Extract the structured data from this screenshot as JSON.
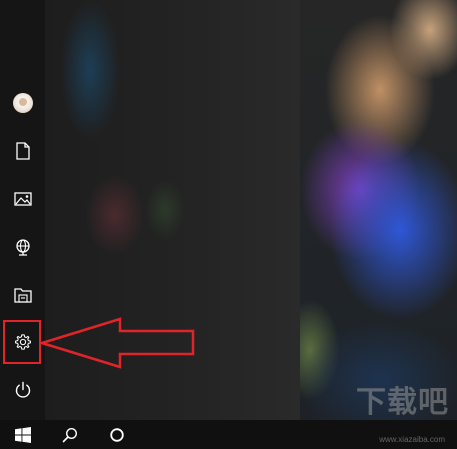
{
  "start_menu": {
    "rail_items": [
      {
        "name": "account",
        "icon": "user-avatar-icon"
      },
      {
        "name": "documents",
        "icon": "document-icon"
      },
      {
        "name": "pictures",
        "icon": "pictures-icon"
      },
      {
        "name": "network",
        "icon": "network-globe-icon"
      },
      {
        "name": "file-explorer",
        "icon": "file-explorer-icon"
      },
      {
        "name": "settings",
        "icon": "gear-icon"
      },
      {
        "name": "power",
        "icon": "power-icon"
      }
    ],
    "highlighted_item": "settings",
    "annotation": {
      "type": "arrow",
      "color": "#e0242a",
      "points_to": "settings"
    }
  },
  "taskbar": {
    "buttons": [
      {
        "name": "start",
        "icon": "windows-logo-icon"
      },
      {
        "name": "search",
        "icon": "search-icon"
      },
      {
        "name": "cortana",
        "icon": "cortana-circle-icon"
      }
    ]
  },
  "watermark": {
    "text": "下载吧",
    "subtext": "www.xiazaiba.com"
  },
  "colors": {
    "rail_bg": "#151515",
    "taskbar_bg": "#101010",
    "annotation_red": "#e0242a",
    "icon_white": "#ffffff"
  }
}
